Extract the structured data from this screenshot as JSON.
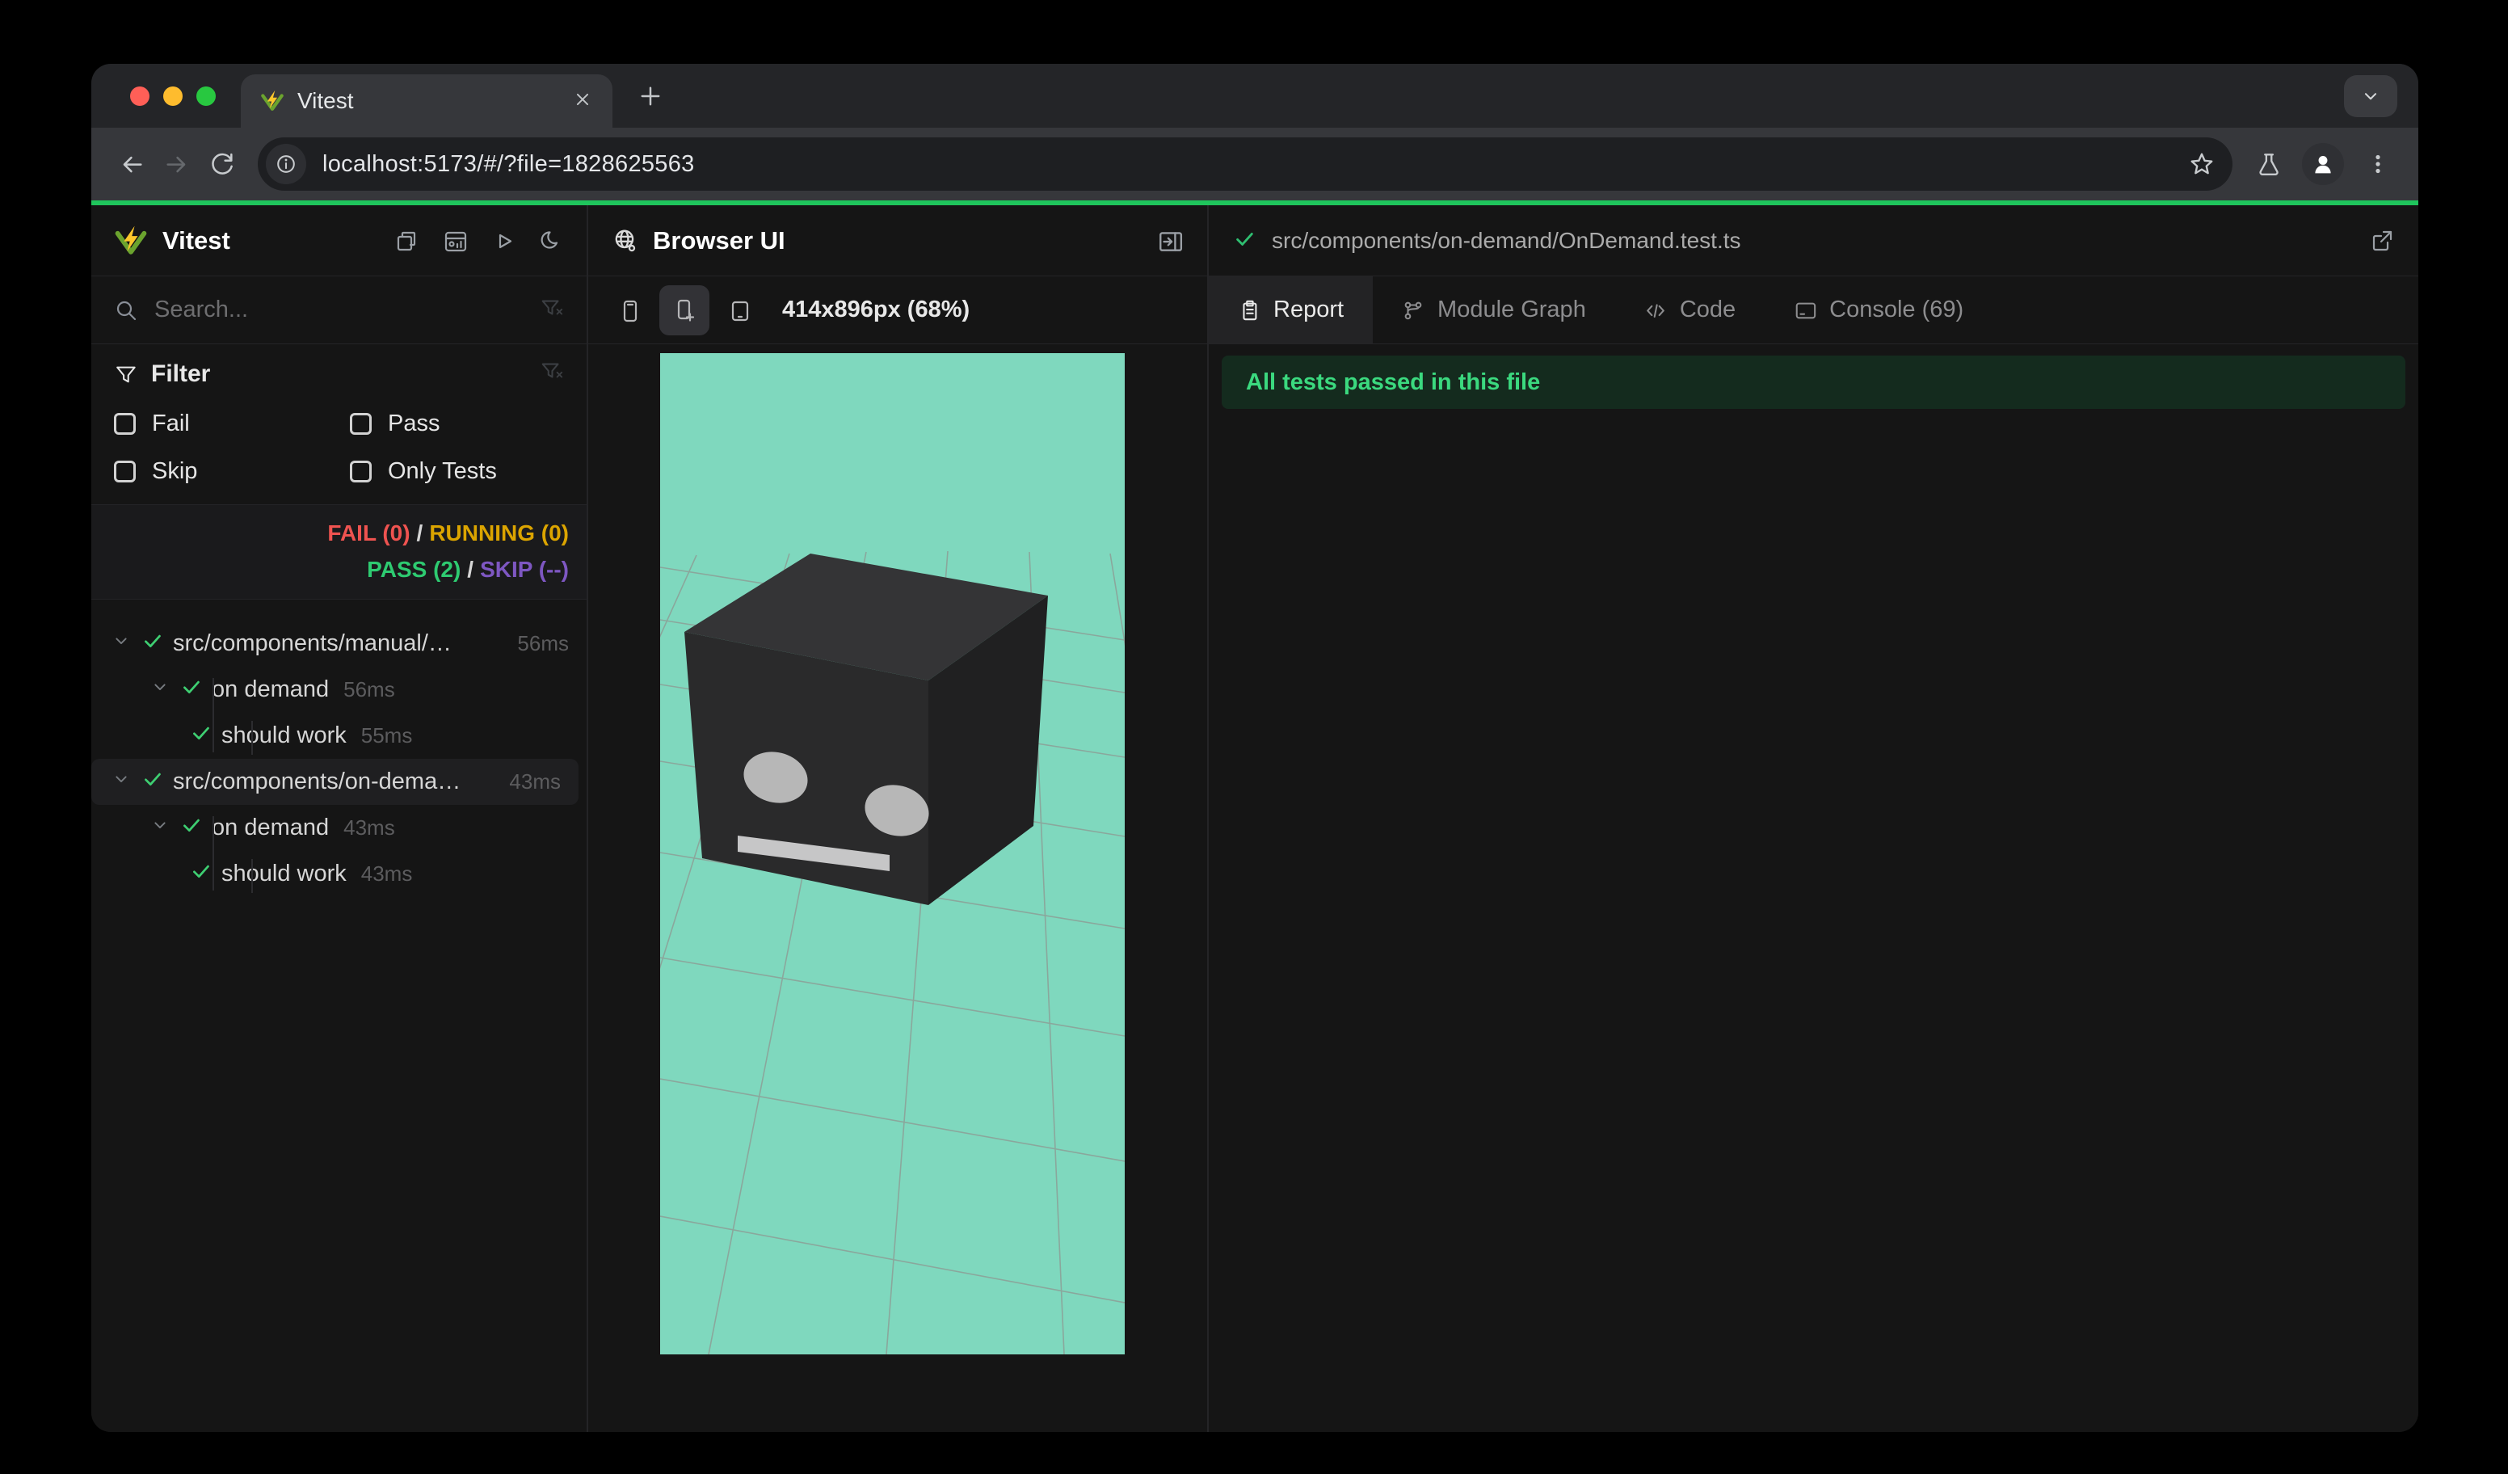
{
  "browser_chrome": {
    "tab_title": "Vitest",
    "url": "localhost:5173/#/?file=1828625563"
  },
  "sidebar": {
    "title": "Vitest",
    "search_placeholder": "Search...",
    "filter": {
      "title": "Filter",
      "options": [
        "Fail",
        "Pass",
        "Skip",
        "Only Tests"
      ]
    },
    "summary": {
      "fail": "FAIL (0)",
      "running": "RUNNING (0)",
      "pass": "PASS (2)",
      "skip": "SKIP (--)",
      "separator": "/"
    },
    "tree": [
      {
        "label": "src/components/manual/…",
        "duration": "56ms"
      },
      {
        "label": "on demand",
        "duration": "56ms"
      },
      {
        "label": "should work",
        "duration": "55ms"
      },
      {
        "label": "src/components/on-dema…",
        "duration": "43ms"
      },
      {
        "label": "on demand",
        "duration": "43ms"
      },
      {
        "label": "should work",
        "duration": "43ms"
      }
    ]
  },
  "browser_panel": {
    "title": "Browser UI",
    "dimensions_label": "414x896px (68%)",
    "viewport": {
      "background": "#7fd8be"
    }
  },
  "report_panel": {
    "file_path": "src/components/on-demand/OnDemand.test.ts",
    "tabs": [
      {
        "label": "Report"
      },
      {
        "label": "Module Graph"
      },
      {
        "label": "Code"
      },
      {
        "label": "Console (69)"
      }
    ],
    "banner": "All tests passed in this file"
  },
  "colors": {
    "pass": "#2ecb71",
    "fail": "#ef5350",
    "running": "#dba400",
    "skip": "#7e57c2",
    "accent_green": "#1fc55c"
  }
}
